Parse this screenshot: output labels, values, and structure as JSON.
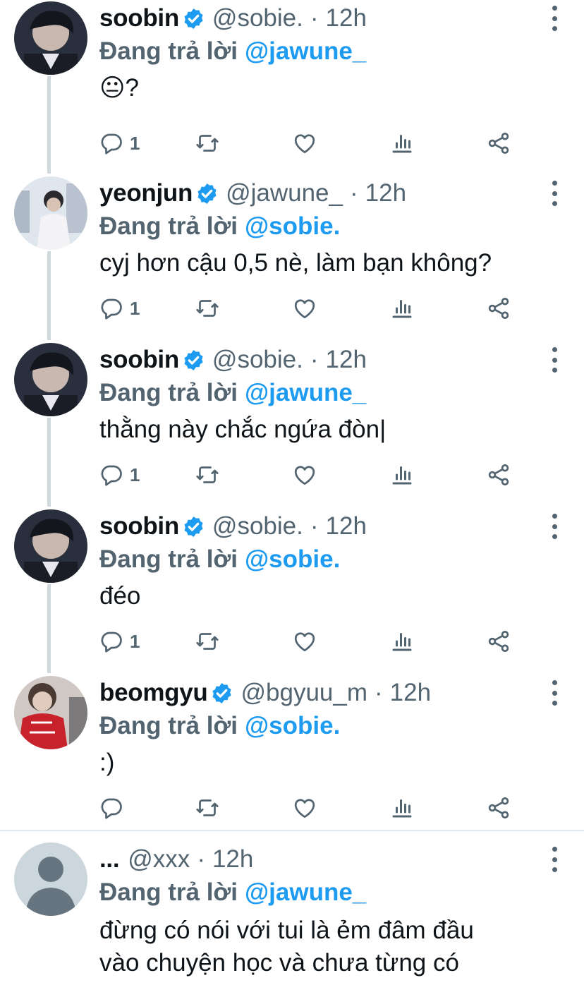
{
  "colors": {
    "accent": "#1d9bf0",
    "secondary_text": "#536471",
    "primary_text": "#0f1419",
    "thread_line": "#cfd9de"
  },
  "tweets": [
    {
      "name": "soobin",
      "handle": "@sobie.",
      "dot": "·",
      "time": "12h",
      "reply_prefix": "Đang trả lời",
      "reply_to": "@jawune_",
      "text": "😐?",
      "reply_count": "1",
      "verified": true
    },
    {
      "name": "yeonjun",
      "handle": "@jawune_",
      "dot": "·",
      "time": "12h",
      "reply_prefix": "Đang trả lời",
      "reply_to": "@sobie.",
      "text": "cyj hơn cậu 0,5 nè, làm bạn không?",
      "reply_count": "1",
      "verified": true
    },
    {
      "name": "soobin",
      "handle": "@sobie.",
      "dot": "·",
      "time": "12h",
      "reply_prefix": "Đang trả lời",
      "reply_to": "@jawune_",
      "text": "thằng này chắc ngứa đòn|",
      "reply_count": "1",
      "verified": true
    },
    {
      "name": "soobin",
      "handle": "@sobie.",
      "dot": "·",
      "time": "12h",
      "reply_prefix": "Đang trả lời",
      "reply_to": "@sobie.",
      "text": "đéo",
      "reply_count": "1",
      "verified": true
    },
    {
      "name": "beomgyu",
      "handle": "@bgyuu_m",
      "dot": "·",
      "time": "12h",
      "reply_prefix": "Đang trả lời",
      "reply_to": "@sobie.",
      "text": ":)",
      "reply_count": "",
      "verified": true
    },
    {
      "name": "...",
      "handle": "@xxx",
      "dot": "·",
      "time": "12h",
      "reply_prefix": "Đang trả lời",
      "reply_to": "@jawune_",
      "text_lines": [
        "đừng có nói với tui là ẻm đâm đầu",
        "vào chuyện học và chưa từng có"
      ],
      "verified": false
    }
  ]
}
